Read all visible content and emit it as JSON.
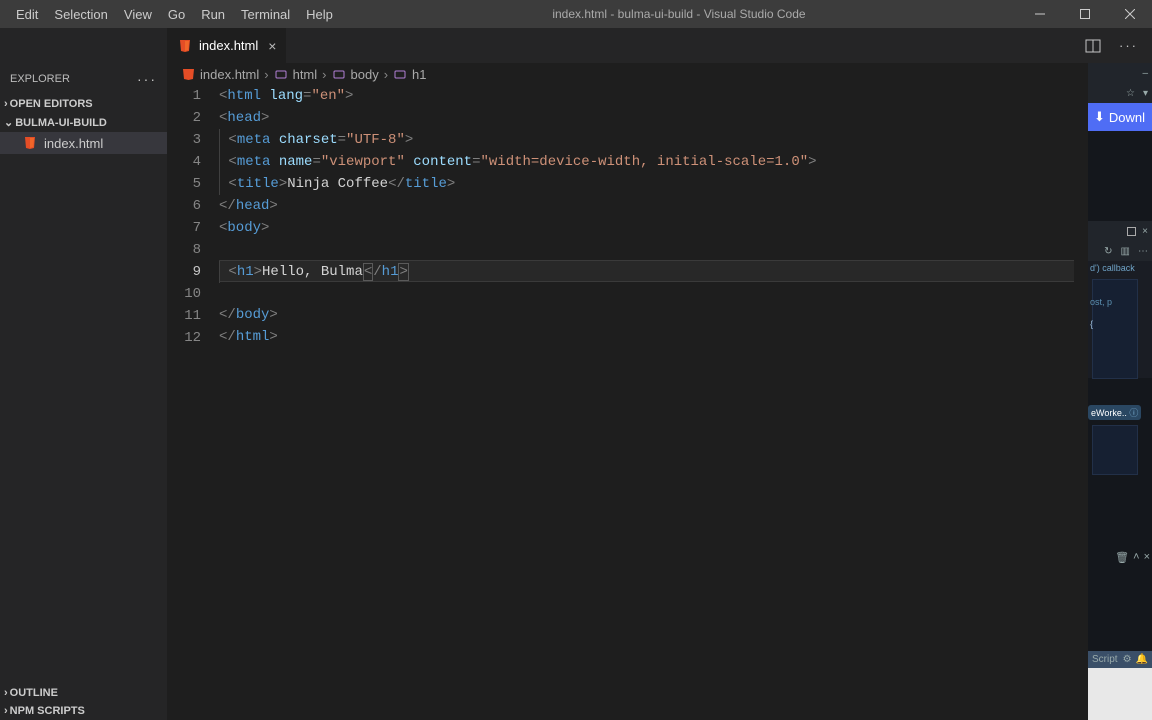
{
  "titlebar": {
    "menu": [
      "Edit",
      "Selection",
      "View",
      "Go",
      "Run",
      "Terminal",
      "Help"
    ],
    "title": "index.html - bulma-ui-build - Visual Studio Code"
  },
  "tabs": {
    "active": {
      "label": "index.html"
    }
  },
  "explorer": {
    "title": "EXPLORER",
    "open_editors": "OPEN EDITORS",
    "folder": "BULMA-UI-BUILD",
    "files": [
      {
        "name": "index.html"
      }
    ],
    "outline": "OUTLINE",
    "npm": "NPM SCRIPTS"
  },
  "breadcrumbs": {
    "file": "index.html",
    "path": [
      "html",
      "body",
      "h1"
    ]
  },
  "code": {
    "lines": [
      {
        "n": 1,
        "tokens": [
          [
            "<",
            "b"
          ],
          [
            "html",
            "t"
          ],
          [
            " ",
            ""
          ],
          [
            "lang",
            "a"
          ],
          [
            "=",
            "b"
          ],
          [
            "\"en\"",
            "s"
          ],
          [
            ">",
            "b"
          ]
        ]
      },
      {
        "n": 2,
        "tokens": [
          [
            "<",
            "b"
          ],
          [
            "head",
            "t"
          ],
          [
            ">",
            "b"
          ]
        ]
      },
      {
        "n": 3,
        "indent": 1,
        "tokens": [
          [
            "<",
            "b"
          ],
          [
            "meta",
            "t"
          ],
          [
            " ",
            ""
          ],
          [
            "charset",
            "a"
          ],
          [
            "=",
            "b"
          ],
          [
            "\"UTF-8\"",
            "s"
          ],
          [
            ">",
            "b"
          ]
        ]
      },
      {
        "n": 4,
        "indent": 1,
        "tokens": [
          [
            "<",
            "b"
          ],
          [
            "meta",
            "t"
          ],
          [
            " ",
            ""
          ],
          [
            "name",
            "a"
          ],
          [
            "=",
            "b"
          ],
          [
            "\"viewport\"",
            "s"
          ],
          [
            " ",
            ""
          ],
          [
            "content",
            "a"
          ],
          [
            "=",
            "b"
          ],
          [
            "\"width=device-width, initial-scale=1.0\"",
            "s"
          ],
          [
            ">",
            "b"
          ]
        ]
      },
      {
        "n": 5,
        "indent": 1,
        "tokens": [
          [
            "<",
            "b"
          ],
          [
            "title",
            "t"
          ],
          [
            ">",
            "b"
          ],
          [
            "Ninja Coffee",
            "x"
          ],
          [
            "</",
            "b"
          ],
          [
            "title",
            "t"
          ],
          [
            ">",
            "b"
          ]
        ]
      },
      {
        "n": 6,
        "tokens": [
          [
            "</",
            "b"
          ],
          [
            "head",
            "t"
          ],
          [
            ">",
            "b"
          ]
        ]
      },
      {
        "n": 7,
        "tokens": [
          [
            "<",
            "b"
          ],
          [
            "body",
            "t"
          ],
          [
            ">",
            "b"
          ]
        ]
      },
      {
        "n": 8,
        "tokens": []
      },
      {
        "n": 9,
        "current": true,
        "indent": 1,
        "tokens": [
          [
            "<",
            "b"
          ],
          [
            "h1",
            "t"
          ],
          [
            ">",
            "b"
          ],
          [
            "Hello, Bulma",
            "x"
          ],
          [
            "<",
            "bx"
          ],
          [
            "/",
            "b"
          ],
          [
            "h1",
            "t"
          ],
          [
            ">",
            "bx"
          ]
        ]
      },
      {
        "n": 10,
        "tokens": []
      },
      {
        "n": 11,
        "tokens": [
          [
            "</",
            "b"
          ],
          [
            "body",
            "t"
          ],
          [
            ">",
            "b"
          ]
        ]
      },
      {
        "n": 12,
        "tokens": [
          [
            "</",
            "b"
          ],
          [
            "html",
            "t"
          ],
          [
            ">",
            "b"
          ]
        ]
      }
    ]
  },
  "right": {
    "download": "Downl",
    "hint1": "d') callback",
    "hint2": "ost, p",
    "label1": "eWorke..",
    "footer": "Script"
  }
}
